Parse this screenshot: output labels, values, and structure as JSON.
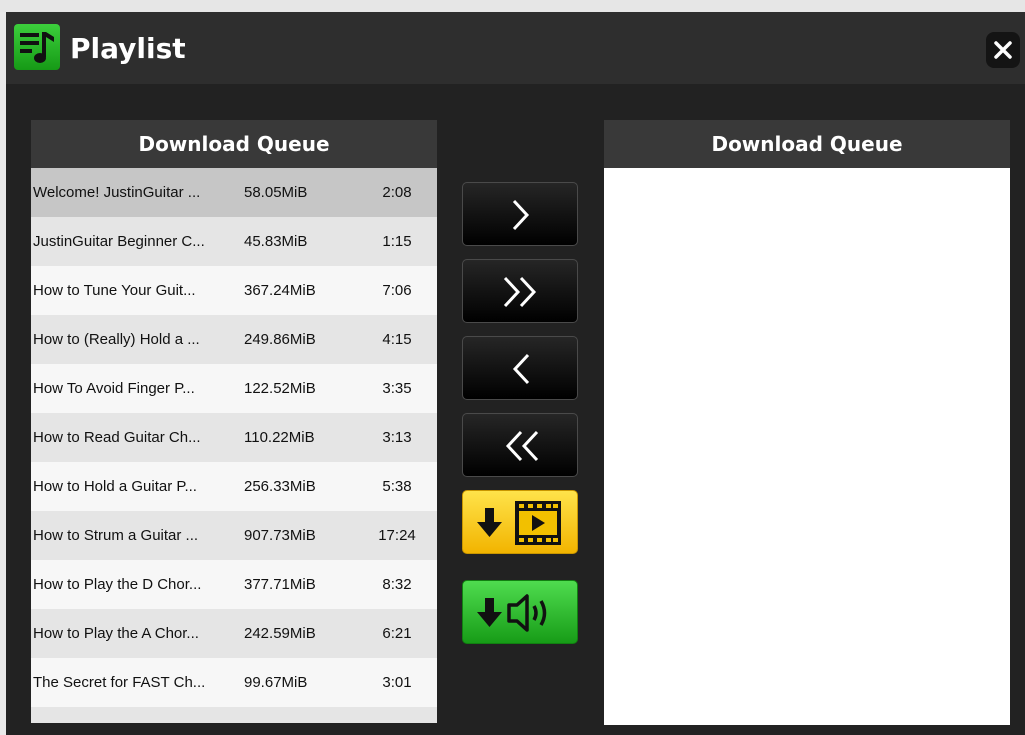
{
  "window": {
    "title": "Playlist"
  },
  "left_panel": {
    "header": "Download Queue",
    "items": [
      {
        "title": "Welcome! JustinGuitar ...",
        "size": "58.05MiB",
        "duration": "2:08"
      },
      {
        "title": "JustinGuitar Beginner C...",
        "size": "45.83MiB",
        "duration": "1:15"
      },
      {
        "title": "How to Tune Your Guit...",
        "size": "367.24MiB",
        "duration": "7:06"
      },
      {
        "title": "How to (Really) Hold a ...",
        "size": "249.86MiB",
        "duration": "4:15"
      },
      {
        "title": "How To Avoid Finger P...",
        "size": "122.52MiB",
        "duration": "3:35"
      },
      {
        "title": "How to Read Guitar Ch...",
        "size": "110.22MiB",
        "duration": "3:13"
      },
      {
        "title": "How to Hold a Guitar P...",
        "size": "256.33MiB",
        "duration": "5:38"
      },
      {
        "title": "How to Strum a Guitar ...",
        "size": "907.73MiB",
        "duration": "17:24"
      },
      {
        "title": "How to Play the D Chor...",
        "size": "377.71MiB",
        "duration": "8:32"
      },
      {
        "title": "How to Play the A Chor...",
        "size": "242.59MiB",
        "duration": "6:21"
      },
      {
        "title": "The Secret for FAST Ch...",
        "size": "99.67MiB",
        "duration": "3:01"
      }
    ]
  },
  "right_panel": {
    "header": "Download Queue"
  },
  "controls": [
    {
      "name": "move-selected-right-button",
      "icon": "chevron-right-icon"
    },
    {
      "name": "move-all-right-button",
      "icon": "double-chevron-right-icon"
    },
    {
      "name": "move-selected-left-button",
      "icon": "chevron-left-icon"
    },
    {
      "name": "move-all-left-button",
      "icon": "double-chevron-left-icon"
    },
    {
      "name": "download-video-button",
      "icon": "download-video-icon"
    },
    {
      "name": "download-audio-button",
      "icon": "download-audio-icon"
    }
  ],
  "colors": {
    "titlebar": "#2e2e2e",
    "window_bg": "#222222",
    "panel_header": "#393939",
    "video_button": "#f7c600",
    "audio_button": "#2fc12f",
    "selected_row": "#c6c6c6"
  }
}
